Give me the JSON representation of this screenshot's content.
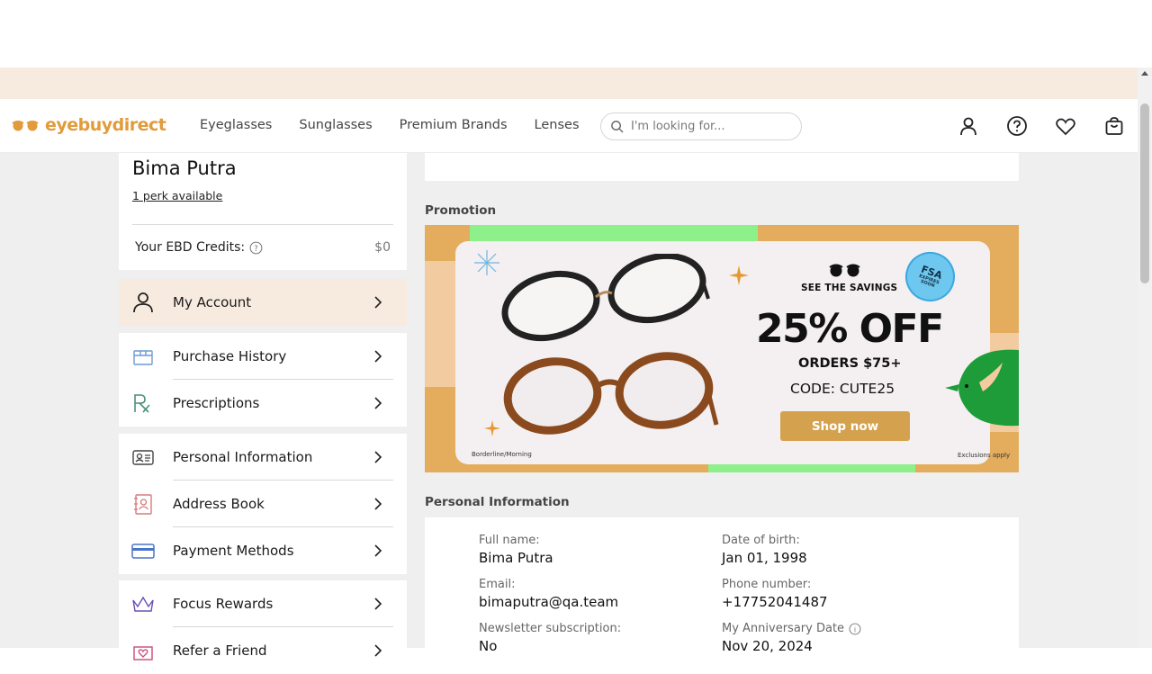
{
  "header": {
    "logo_text": "eyebuydirect",
    "nav": [
      "Eyeglasses",
      "Sunglasses",
      "Premium Brands",
      "Lenses"
    ],
    "search_placeholder": "I'm looking for..."
  },
  "profile": {
    "name": "Bima Putra",
    "perk": "1 perk available",
    "credits_label": "Your EBD Credits:",
    "credits_value": "$0"
  },
  "menu": {
    "account": "My Account",
    "group1": [
      "Purchase History",
      "Prescriptions"
    ],
    "group2": [
      "Personal Information",
      "Address Book",
      "Payment Methods"
    ],
    "group3": [
      "Focus Rewards",
      "Refer a Friend"
    ]
  },
  "sections": {
    "promotion": "Promotion",
    "personal_info": "Personal Information"
  },
  "banner": {
    "see": "SEE THE SAVINGS",
    "off": "25% OFF",
    "orders": "ORDERS $75+",
    "code": "CODE: CUTE25",
    "cta": "Shop now",
    "fsa": "FSA",
    "fsa_sub": "EXPIRES SOON",
    "frame_tag": "Borderline/Morning",
    "exclusions": "Exclusions apply"
  },
  "personal": {
    "full_name_label": "Full name:",
    "full_name": "Bima Putra",
    "dob_label": "Date of birth:",
    "dob": "Jan 01, 1998",
    "email_label": "Email:",
    "email": "bimaputra@qa.team",
    "phone_label": "Phone number:",
    "phone": "+17752041487",
    "newsletter_label": "Newsletter subscription:",
    "newsletter": "No",
    "anniversary_label": "My Anniversary Date",
    "anniversary": "Nov 20, 2024"
  },
  "colors": {
    "brand": "#e19b3b",
    "active_bg": "#f7ebdf",
    "page_bg": "#efefef"
  }
}
